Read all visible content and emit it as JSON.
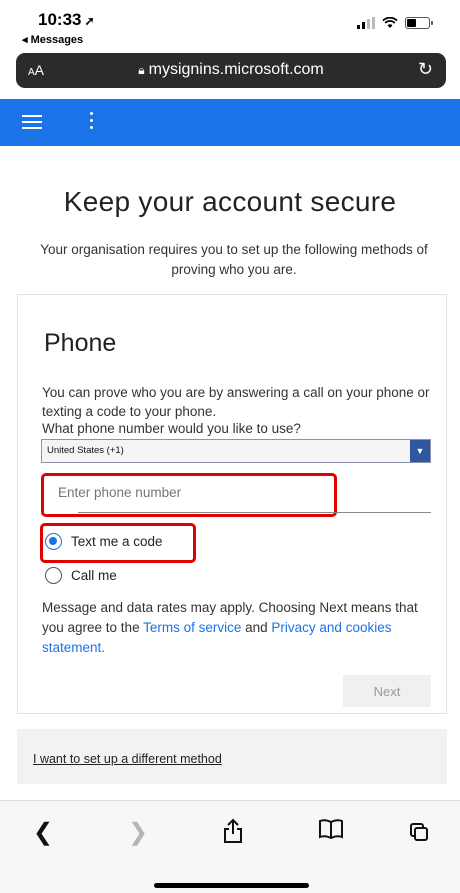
{
  "status_bar": {
    "time": "10:33",
    "back_app": "◂ Messages",
    "battery_level": 0.45
  },
  "browser": {
    "text_size_label": "AA",
    "url": "mysignins.microsoft.com"
  },
  "page": {
    "title": "Keep your account secure",
    "subtitle": "Your organisation requires you to set up the following methods of proving who you are."
  },
  "phone_card": {
    "title": "Phone",
    "description": "You can prove who you are by answering a call on your phone or texting a code to your phone.",
    "question": "What phone number would you like to use?",
    "country": "United States (+1)",
    "phone_placeholder": "Enter phone number",
    "options": {
      "text": "Text me a code",
      "call": "Call me",
      "selected": "text"
    },
    "disclaimer_pre": "Message and data rates may apply. Choosing Next means that you agree to the ",
    "terms_link": "Terms of service",
    "disclaimer_mid": " and ",
    "privacy_link": "Privacy and cookies statement.",
    "next_label": "Next"
  },
  "footer": {
    "alt_method_link": "I want to set up a different method"
  },
  "toolbar": {
    "icons": [
      "back-icon",
      "forward-icon",
      "share-icon",
      "bookmarks-icon",
      "tabs-icon"
    ]
  },
  "colors": {
    "accent": "#1a73e8",
    "highlight": "#e00000",
    "select_arrow": "#2f57a0"
  }
}
